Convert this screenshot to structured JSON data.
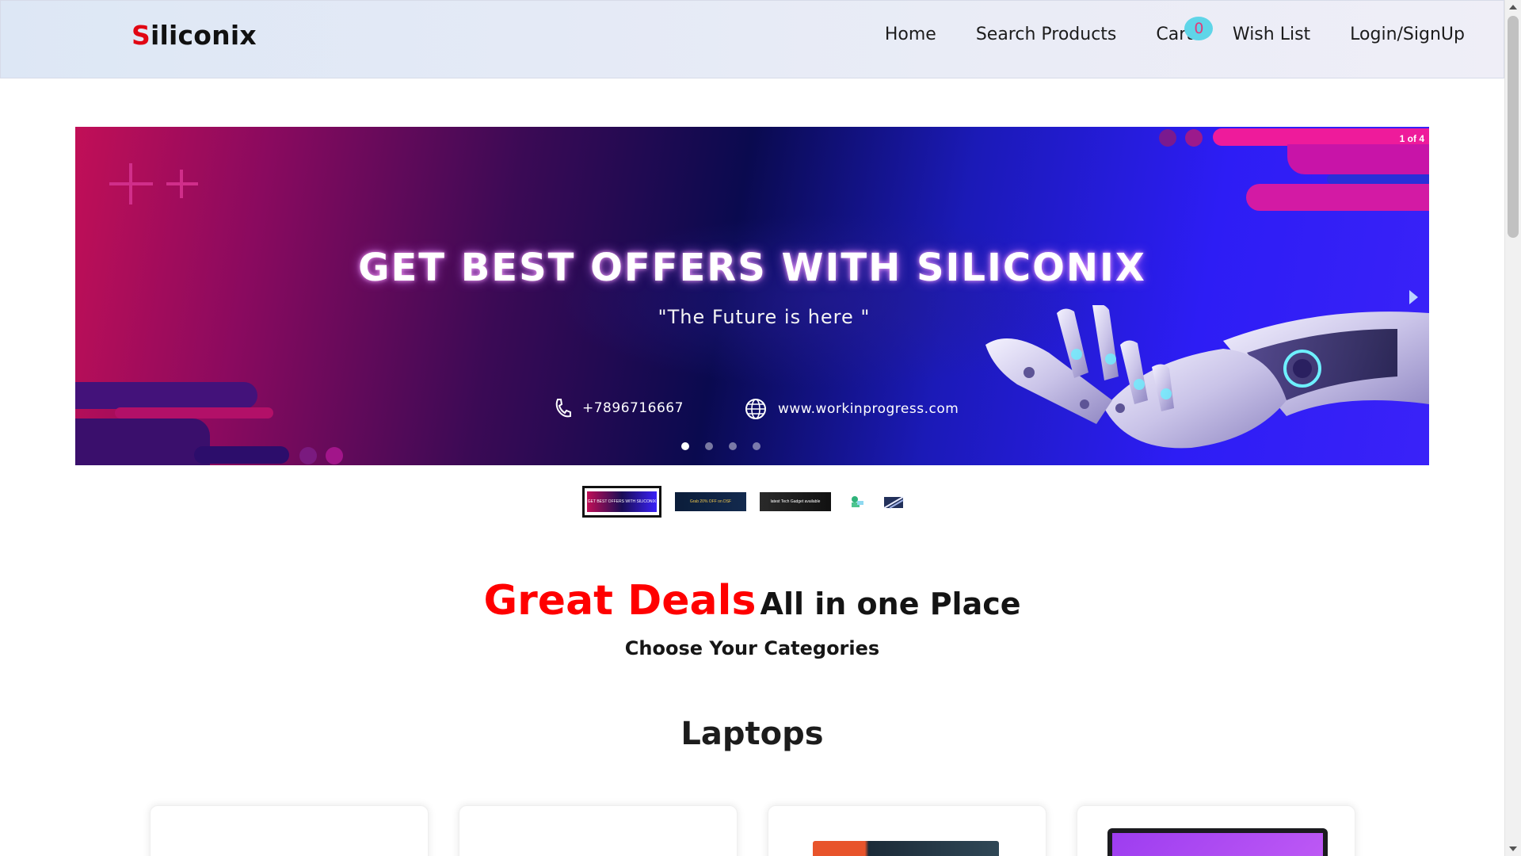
{
  "navbar": {
    "brand_first": "S",
    "brand_rest": "iliconix",
    "links": [
      {
        "label": "Home"
      },
      {
        "label": "Search Products"
      },
      {
        "label": "Cart"
      },
      {
        "label": "Wish List"
      },
      {
        "label": "Login/SignUp"
      }
    ],
    "cart_count": "0"
  },
  "carousel": {
    "counter": "1 of 4",
    "title": "GET BEST OFFERS WITH SILICONIX",
    "tagline": "\"The Future is here \"",
    "phone": "+7896716667",
    "website": "www.workinprogress.com",
    "slide_count": 4,
    "active_slide": 1
  },
  "thumbnails": [
    {
      "text": "GET BEST OFFERS WITH SILICONIX"
    },
    {
      "text": "Grab 20% OFF on DSF"
    },
    {
      "text": "latest Tech Gadget available"
    },
    {
      "text": ""
    },
    {
      "text": ""
    }
  ],
  "main": {
    "deals_highlight": "Great Deals",
    "deals_rest": "All in one Place",
    "subtitle": "Choose Your Categories",
    "section_title": "Laptops"
  },
  "colors": {
    "brand_red": "#e10613",
    "deals_red": "#ff0000",
    "cart_badge": "#5fd5e8"
  }
}
